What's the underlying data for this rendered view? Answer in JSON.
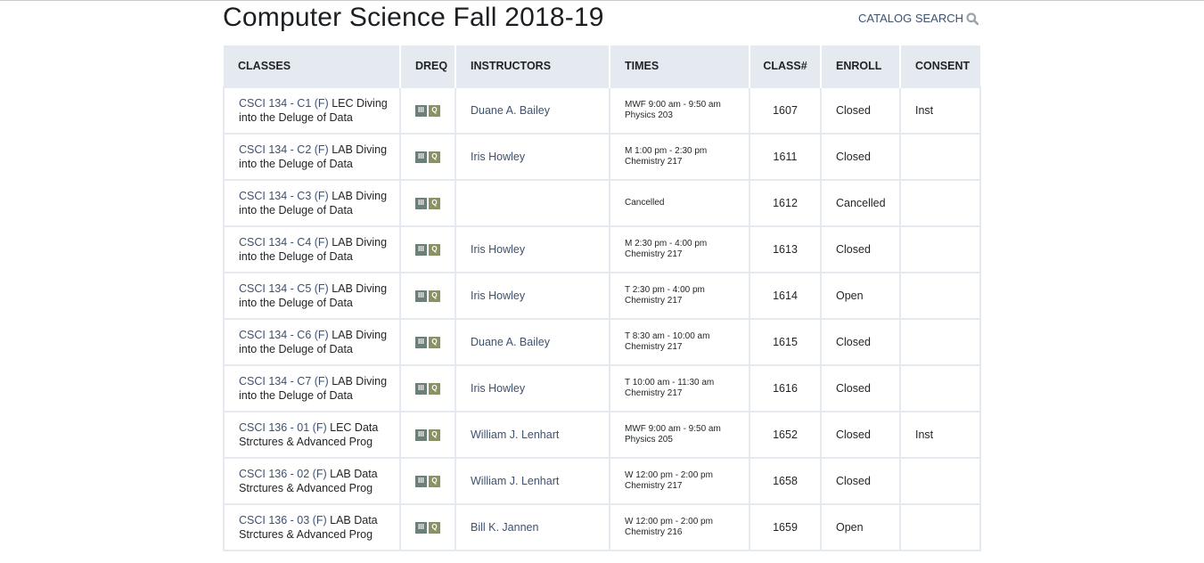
{
  "page": {
    "title": "Computer Science Fall 2018-19"
  },
  "header": {
    "catalog_search_label": "CATALOG SEARCH"
  },
  "table": {
    "columns": [
      "CLASSES",
      "DREQ",
      "INSTRUCTORS",
      "TIMES",
      "CLASS#",
      "ENROLL",
      "CONSENT"
    ],
    "rows": [
      {
        "code": "CSCI 134 - C1 (F)",
        "name": "LEC Diving into the Deluge of Data",
        "dreq": [
          "III",
          "Q"
        ],
        "instructor": "Duane A. Bailey",
        "time": "MWF 9:00 am - 9:50 am",
        "location": "Physics 203",
        "class_num": "1607",
        "enroll": "Closed",
        "consent": "Inst"
      },
      {
        "code": "CSCI 134 - C2 (F)",
        "name": "LAB Diving into the Deluge of Data",
        "dreq": [
          "III",
          "Q"
        ],
        "instructor": "Iris Howley",
        "time": "M 1:00 pm - 2:30 pm",
        "location": "Chemistry 217",
        "class_num": "1611",
        "enroll": "Closed",
        "consent": ""
      },
      {
        "code": "CSCI 134 - C3 (F)",
        "name": "LAB Diving into the Deluge of Data",
        "dreq": [
          "III",
          "Q"
        ],
        "instructor": "",
        "time": "Cancelled",
        "location": "",
        "class_num": "1612",
        "enroll": "Cancelled",
        "consent": ""
      },
      {
        "code": "CSCI 134 - C4 (F)",
        "name": "LAB Diving into the Deluge of Data",
        "dreq": [
          "III",
          "Q"
        ],
        "instructor": "Iris Howley",
        "time": "M 2:30 pm - 4:00 pm",
        "location": "Chemistry 217",
        "class_num": "1613",
        "enroll": "Closed",
        "consent": ""
      },
      {
        "code": "CSCI 134 - C5 (F)",
        "name": "LAB Diving into the Deluge of Data",
        "dreq": [
          "III",
          "Q"
        ],
        "instructor": "Iris Howley",
        "time": "T 2:30 pm - 4:00 pm",
        "location": "Chemistry 217",
        "class_num": "1614",
        "enroll": "Open",
        "consent": ""
      },
      {
        "code": "CSCI 134 - C6 (F)",
        "name": "LAB Diving into the Deluge of Data",
        "dreq": [
          "III",
          "Q"
        ],
        "instructor": "Duane A. Bailey",
        "time": "T 8:30 am - 10:00 am",
        "location": "Chemistry 217",
        "class_num": "1615",
        "enroll": "Closed",
        "consent": ""
      },
      {
        "code": "CSCI 134 - C7 (F)",
        "name": "LAB Diving into the Deluge of Data",
        "dreq": [
          "III",
          "Q"
        ],
        "instructor": "Iris Howley",
        "time": "T 10:00 am - 11:30 am",
        "location": "Chemistry 217",
        "class_num": "1616",
        "enroll": "Closed",
        "consent": ""
      },
      {
        "code": "CSCI 136 - 01 (F)",
        "name": "LEC Data Strctures & Advanced Prog",
        "dreq": [
          "III",
          "Q"
        ],
        "instructor": "William J. Lenhart",
        "time": "MWF 9:00 am - 9:50 am",
        "location": "Physics 205",
        "class_num": "1652",
        "enroll": "Closed",
        "consent": "Inst"
      },
      {
        "code": "CSCI 136 - 02 (F)",
        "name": "LAB Data Strctures & Advanced Prog",
        "dreq": [
          "III",
          "Q"
        ],
        "instructor": "William J. Lenhart",
        "time": "W 12:00 pm - 2:00 pm",
        "location": "Chemistry 217",
        "class_num": "1658",
        "enroll": "Closed",
        "consent": ""
      },
      {
        "code": "CSCI 136 - 03 (F)",
        "name": "LAB Data Strctures & Advanced Prog",
        "dreq": [
          "III",
          "Q"
        ],
        "instructor": "Bill K. Jannen",
        "time": "W 12:00 pm - 2:00 pm",
        "location": "Chemistry 216",
        "class_num": "1659",
        "enroll": "Open",
        "consent": ""
      }
    ]
  },
  "colors": {
    "link": "#3d5170",
    "header_bg": "#e5eaf1",
    "badge_dept": "#6c8078",
    "badge_q": "#8a9166"
  },
  "icons": {
    "catalog_search": "search-icon"
  }
}
